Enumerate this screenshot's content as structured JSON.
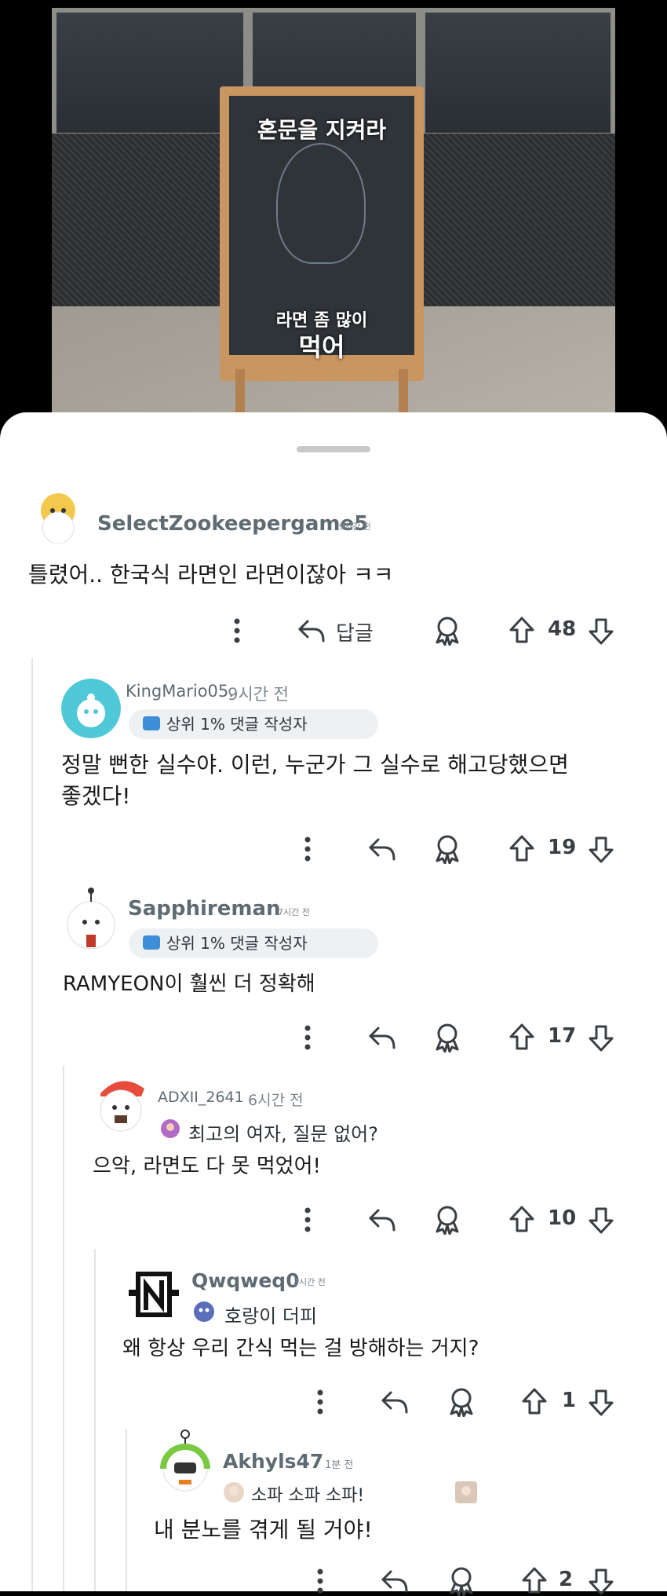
{
  "post_image": {
    "sign_top": "혼문을 지켜라",
    "sign_bottom_small": "라면 좀 많이",
    "sign_bottom_big": "먹어"
  },
  "comments": [
    {
      "username": "SelectZookeepergame5",
      "time": "9시간 전",
      "body": "틀렸어.. 한국식 라면인 라면이잖아 ㅋㅋ",
      "reply_label": "답글",
      "score": "48"
    },
    {
      "username": "KingMario05.",
      "time": "9시간 전",
      "flair": "상위 1% 댓글 작성자",
      "body_line1": "정말 뻔한 실수야. 이런, 누군가 그 실수로 해고당했으면",
      "body_line2": "좋겠다!",
      "score": "19"
    },
    {
      "username": "Sapphireman",
      "time": "7시간 전",
      "flair": "상위 1% 댓글 작성자",
      "body": "RAMYEON이 훨씬 더 정확해",
      "score": "17"
    },
    {
      "username": "ADXII_2641",
      "time": "6시간 전",
      "flair": "최고의 여자, 질문 없어?",
      "body": "으악, 라면도 다 못 먹었어!",
      "score": "10"
    },
    {
      "username": "Qwqweq0",
      "time": "3시간 전",
      "flair": "호랑이 더피",
      "body": "왜 항상 우리 간식 먹는 걸 방해하는 거지?",
      "score": "1"
    },
    {
      "username": "Akhyls47",
      "time": "1분 전",
      "flair": "소파 소파 소파!",
      "body": "내 분노를 겪게 될 거야!",
      "score": "2"
    }
  ],
  "icons": {
    "more": "more-options-icon",
    "reply": "reply-arrow-icon",
    "award": "award-icon",
    "upvote": "upvote-arrow-icon",
    "downvote": "downvote-arrow-icon"
  },
  "colors": {
    "sheet": "#ffffff",
    "flair_bg": "#eef1f4",
    "username": "#5f6b73",
    "thread_line": "#e1e4e6"
  }
}
